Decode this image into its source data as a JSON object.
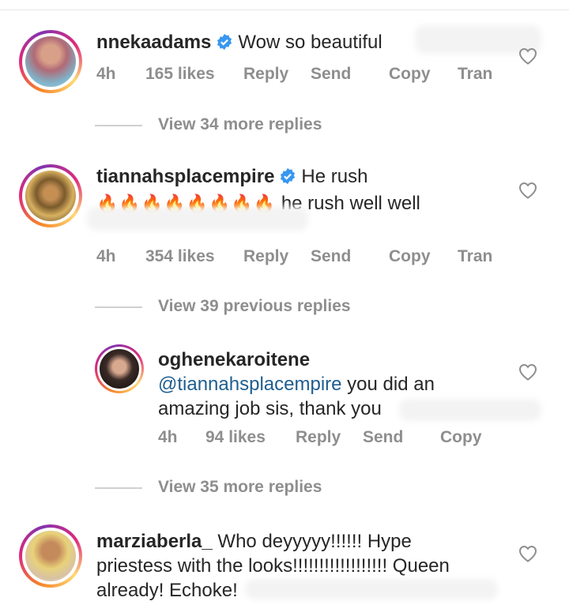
{
  "comments": [
    {
      "username": "nnekaadams",
      "verified": true,
      "text": "Wow so beautiful",
      "time": "4h",
      "likes": "165 likes",
      "reply": "Reply",
      "send": "Send",
      "copy": "Copy",
      "translate": "Tran"
    },
    {
      "username": "tiannahsplacempire",
      "verified": true,
      "text_line1": "He rush",
      "emojis": "🔥🔥🔥🔥🔥🔥🔥🔥",
      "text_line2": "he rush well well",
      "time": "4h",
      "likes": "354 likes",
      "reply": "Reply",
      "send": "Send",
      "copy": "Copy",
      "translate": "Tran"
    },
    {
      "username": "oghenekaroitene",
      "mention": "@tiannahsplacempire",
      "text_line1": " you did an",
      "text_line2": "amazing job sis, thank you",
      "time": "4h",
      "likes": "94 likes",
      "reply": "Reply",
      "send": "Send",
      "copy": "Copy"
    },
    {
      "username": "marziaberla_",
      "text_line1": " Who deyyyyy!!!!!! Hype",
      "text_line2": "priestess with the looks!!!!!!!!!!!!!!!!!! Queen",
      "text_line3": "already! Echoke!"
    }
  ],
  "view_replies": {
    "first": "View 34 more replies",
    "second": "View 39 previous replies",
    "third": "View 35 more replies"
  },
  "colors": {
    "mention": "#1f5e8f",
    "verified": "#3897f0",
    "meta": "#8e8e8e"
  }
}
